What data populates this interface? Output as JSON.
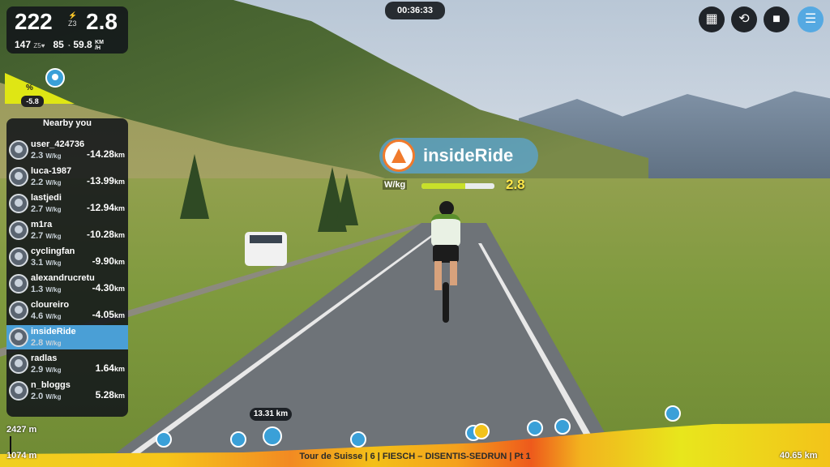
{
  "stats": {
    "power": "222",
    "zone": "Z3",
    "wkg": "2.8",
    "heart_rate": "147",
    "hr_zone": "Z5",
    "cadence": "85",
    "speed": "59.8",
    "speed_unit_top": "KM",
    "speed_unit_bottom": "/H"
  },
  "grade": {
    "percent_symbol": "%",
    "value": "-5.8"
  },
  "timer": "00:36:33",
  "controls": [
    "map-icon",
    "replay-icon",
    "stop-icon",
    "menu-icon"
  ],
  "brand": {
    "name": "insideRide"
  },
  "wkg_meter": {
    "label": "W/kg",
    "value": "2.8",
    "fill_fraction": 0.6
  },
  "nearby": {
    "title": "Nearby you",
    "wkg_unit": "W/kg",
    "dist_unit": "km",
    "riders": [
      {
        "name": "user_424736",
        "wkg": "2.3",
        "gap": "-14.28"
      },
      {
        "name": "luca-1987",
        "wkg": "2.2",
        "gap": "-13.99"
      },
      {
        "name": "lastjedi",
        "wkg": "2.7",
        "gap": "-12.94"
      },
      {
        "name": "m1ra",
        "wkg": "2.7",
        "gap": "-10.28"
      },
      {
        "name": "cyclingfan",
        "wkg": "3.1",
        "gap": "-9.90"
      },
      {
        "name": "alexandrucretu",
        "wkg": "1.3",
        "gap": "-4.30"
      },
      {
        "name": "cloureiro",
        "wkg": "4.6",
        "gap": "-4.05"
      },
      {
        "name": "insideRide",
        "wkg": "2.8",
        "gap": ""
      },
      {
        "name": "radlas",
        "wkg": "2.9",
        "gap": "1.64"
      },
      {
        "name": "n_bloggs",
        "wkg": "2.0",
        "gap": "5.28"
      }
    ]
  },
  "profile": {
    "max_elevation": "2427 m",
    "min_elevation": "1074 m",
    "total_distance": "40.65 km",
    "current_distance": "13.31 km",
    "route_title": "Tour de Suisse | 6 | FIESCH – DISENTIS-SEDRUN | Pt 1"
  },
  "colors": {
    "accent": "#4a9fd6",
    "brand_orange": "#f07a2c",
    "wkg_yellow": "#ffe84a"
  }
}
